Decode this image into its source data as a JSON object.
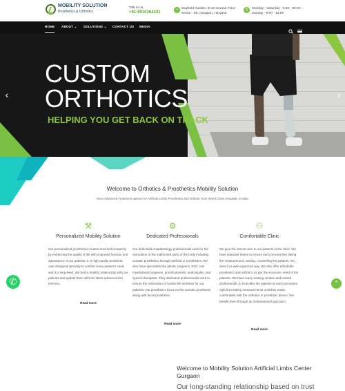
{
  "header": {
    "logo_main": "MOBILITY SOLUTION",
    "logo_sub": "Prosthetics & Orthotics",
    "talk_label": "Talk to us",
    "phone": "+91-9910364331",
    "address_line1": "Mayfield Garden, B-16 Ground Floor",
    "address_line2": "Sector - 50, Gurgaon, Haryana",
    "hours_line1": "Monday - Saturday - 9:00 - 06:00",
    "hours_line2": "Sunday - 9:00 - 14:00"
  },
  "nav": {
    "items": [
      {
        "label": "HOME"
      },
      {
        "label": "ABOUT ⌄"
      },
      {
        "label": "SOLUTIONS ⌄"
      },
      {
        "label": "CONTACT US"
      },
      {
        "label": "MEDIA"
      }
    ],
    "search_icon": "search-icon",
    "menu_icon": "menu-icon"
  },
  "hero": {
    "title_line1": "CUSTOM",
    "title_line2": "ORTHOTICS",
    "tagline": "HELPING YOU GET BACK ON TRACK",
    "prev_icon": "chevron-left-icon",
    "next_icon": "chevron-right-icon"
  },
  "intro": {
    "heading": "Welcome to Orthotics & Prosthetics Mobility Solution",
    "subheading": "Most Advanced Treatment options for Artificial Limbs Prosthetics and Orthotic from World Class Hospitals in India"
  },
  "cards": [
    {
      "icon": "wrench-icon",
      "title": "Personalized Mobility Solution",
      "body": "Our personalized prosthetics creates trust and prosperity by enhancing the quality of life with improved function and appearance of our patients. It is high-quality prosthetic care designed specially to comfort every patient's need and it is long-lived. We built a healthy relationship with our patients and update them with the latest advancement technics.",
      "link": "Read more"
    },
    {
      "icon": "robot-arm-icon",
      "title": "Dedicated Professionals",
      "body": "Our dedicated Anaplastology professionals work for the restoration of the malformed parts of the body including somatic prosthetics through artificial or prosthetics. We also have specialists like plastic surgeons, ENT, oral maxillofacial surgeons, prosthodontists, audiologists, and speech therapists. They dedicated professionals work to ensure the restoration of routine life activities for our patients. Our prosthetics focus on the somatic prosthesis along with facial prosthesis.",
      "link": "Read more"
    },
    {
      "icon": "family-icon",
      "title": "Comfortable Clinic",
      "body": "We give the utmost care to our patients in the clinic. We have separate teams to ensure each process like taking the measurement, casting, counseling the patients, etc., done in a well-organized way. We also offer affordable prosthetics and orthotics as per the economic need of the patients. We have many training centers and trained professionals to look after the patients at each procedure right from taking measurements until they made comfortable with the orthotics or prosthetic device. We benefit them through an individualized approach.",
      "link": "Read more"
    }
  ],
  "bottom": {
    "heading": "Welcome to Mobility Solution Artificial Limbs Center Gurgaon",
    "tagline": "Our long-standing relationship based on trust"
  },
  "floating": {
    "whatsapp_icon": "whatsapp-icon",
    "scroll_up_icon": "chevron-up-icon"
  },
  "colors": {
    "accent_green": "#8dc63f",
    "dark": "#171717",
    "teal": "#1ccbc2",
    "text": "#333333"
  }
}
